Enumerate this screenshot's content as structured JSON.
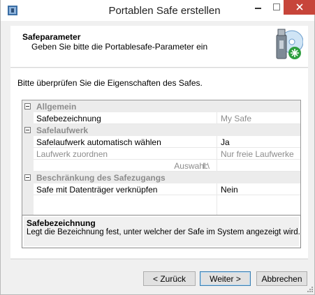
{
  "window": {
    "title": "Portablen Safe erstellen"
  },
  "header": {
    "title": "Safeparameter",
    "subtitle": "Geben Sie bitte die Portablesafe-Parameter ein"
  },
  "content": {
    "instruction": "Bitte überprüfen Sie die Eigenschaften des Safes."
  },
  "grid": {
    "categories": {
      "general": "Allgemein",
      "drive": "Safelaufwerk",
      "restriction": "Beschränkung des Safezugangs"
    },
    "rows": {
      "safe_name": {
        "name": "Safebezeichnung",
        "value": "My Safe"
      },
      "auto_drive": {
        "name": "Safelaufwerk automatisch wählen",
        "value": "Ja"
      },
      "assign_drive": {
        "name": "Laufwerk zuordnen",
        "value": "Nur freie Laufwerke"
      },
      "selection": {
        "name": "Auswahl:",
        "value": "I:\\"
      },
      "link_media": {
        "name": "Safe mit Datenträger verknüpfen",
        "value": "Nein"
      }
    }
  },
  "description": {
    "title": "Safebezeichnung",
    "text": "Legt die Bezeichnung fest, unter welcher der Safe im System angezeigt wird."
  },
  "buttons": {
    "back": "< Zurück",
    "next": "Weiter >",
    "cancel": "Abbrechen"
  },
  "colors": {
    "close_button": "#c7453a",
    "default_button_border": "#3c7fb1"
  },
  "icons": {
    "app": "safe-app-icon",
    "header": "usb-safe-disc-icon"
  }
}
